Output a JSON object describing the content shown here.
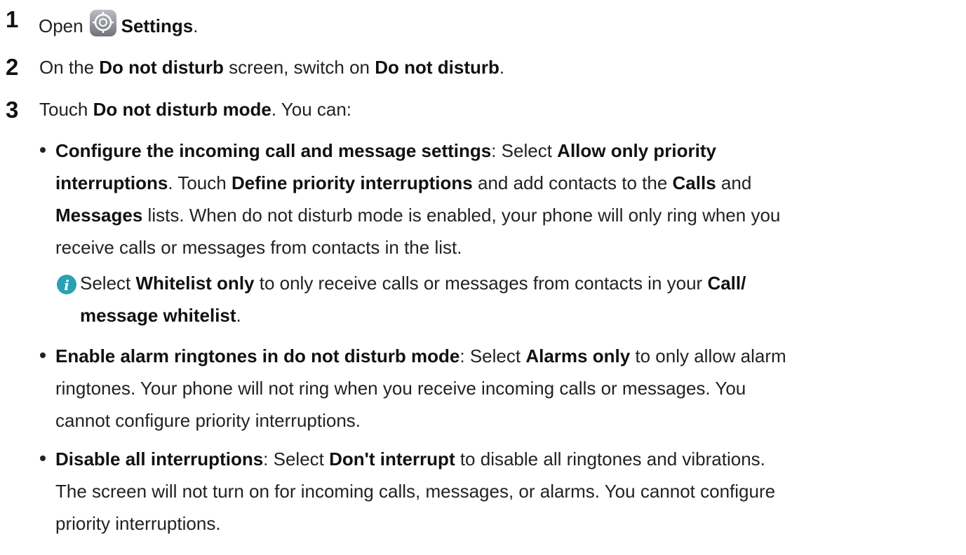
{
  "step1": {
    "number": "1",
    "prefix": "Open",
    "icon": "settings-gear-icon",
    "settings_label": "Settings",
    "suffix": "."
  },
  "step2": {
    "number": "2",
    "t1": "On the ",
    "b1": "Do not disturb",
    "t2": " screen, switch on ",
    "b2": "Do not disturb",
    "t3": "."
  },
  "step3": {
    "number": "3",
    "t1": "Touch ",
    "b1": "Do not disturb mode",
    "t2": ". You can:"
  },
  "bullet1": {
    "line1": {
      "b1": "Configure the incoming call and message settings",
      "t1": ": Select ",
      "b2": "Allow only priority"
    },
    "line2": {
      "b1": "interruptions",
      "t1": ". Touch ",
      "b2": "Define priority interruptions",
      "t2": " and add contacts to the ",
      "b3": "Calls",
      "t3": " and"
    },
    "line3": {
      "b1": "Messages",
      "t1": " lists. When do not disturb mode is enabled, your phone will only ring when you"
    },
    "line4": {
      "t1": "receive calls or messages from contacts in the list."
    }
  },
  "note": {
    "icon": "info-icon",
    "icon_color": "#2aa0b5",
    "line1": {
      "t1": "Select ",
      "b1": "Whitelist only",
      "t2": " to only receive calls or messages from contacts in your ",
      "b2": "Call/"
    },
    "line2": {
      "b1": "message whitelist",
      "t1": "."
    }
  },
  "bullet2": {
    "line1": {
      "b1": "Enable alarm ringtones in do not disturb mode",
      "t1": ": Select ",
      "b2": "Alarms only",
      "t2": " to only allow alarm"
    },
    "line2": {
      "t1": "ringtones. Your phone will not ring when you receive incoming calls or messages. You"
    },
    "line3": {
      "t1": "cannot configure priority interruptions."
    }
  },
  "bullet3": {
    "line1": {
      "b1": "Disable all interruptions",
      "t1": ": Select ",
      "b2": "Don't interrupt",
      "t2": " to disable all ringtones and vibrations."
    },
    "line2": {
      "t1": "The screen will not turn on for incoming calls, messages, or alarms. You cannot configure"
    },
    "line3": {
      "t1": "priority interruptions."
    }
  }
}
